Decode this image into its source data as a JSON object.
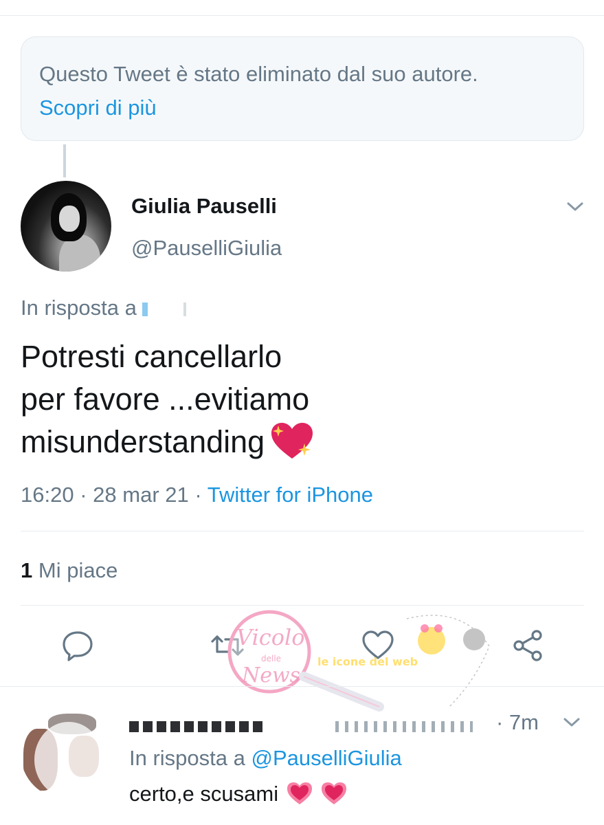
{
  "deleted_notice": {
    "text": "Questo Tweet è stato eliminato dal suo autore.",
    "link": "Scopri di più"
  },
  "tweet": {
    "author_name": "Giulia Pauselli",
    "author_handle": "@PauselliGiulia",
    "reply_to_prefix": "In risposta a",
    "text_lines": [
      "Potresti cancellarlo",
      "per favore ...evitiamo",
      "misunderstanding"
    ],
    "time": "16:20",
    "date": "28 mar 21",
    "source": "Twitter for iPhone",
    "separator": "·",
    "likes_count": "1",
    "likes_label": "Mi piace"
  },
  "reply": {
    "time": "· 7m",
    "reply_to_prefix": "In risposta a",
    "reply_to_handle": "@PauselliGiulia",
    "text": "certo,e scusami"
  },
  "watermark": {
    "text_1": "Vicolo",
    "text_2": "delle",
    "text_3": "News",
    "text_4": "le icone del web"
  },
  "icons": {
    "chevron": "chevron-down-icon",
    "reply": "comment-icon",
    "retweet": "retweet-icon",
    "like": "heart-outline-icon",
    "share": "share-icon",
    "emoji_sparkle_heart": "sparkling-heart-emoji",
    "emoji_heart": "growing-heart-emoji"
  },
  "colors": {
    "link": "#1b95e0",
    "secondary_text": "#657786",
    "primary_text": "#14171a",
    "divider": "#e6ecf0",
    "notice_bg": "#f5f8fa",
    "heart": "#e0245e"
  }
}
